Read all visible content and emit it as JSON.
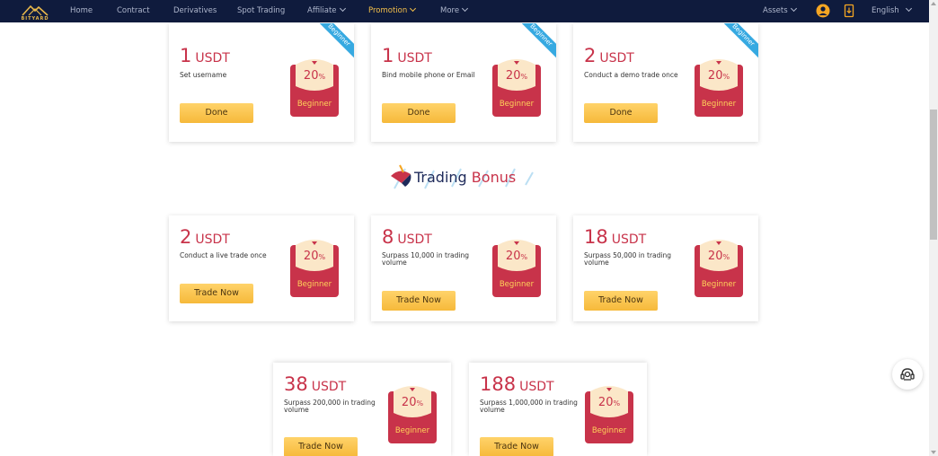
{
  "nav": {
    "logo_text": "BITYARD",
    "items": [
      {
        "label": "Home"
      },
      {
        "label": "Contract"
      },
      {
        "label": "Derivatives"
      },
      {
        "label": "Spot Trading"
      },
      {
        "label": "Affiliate"
      },
      {
        "label": "Promotion"
      },
      {
        "label": "More"
      }
    ],
    "assets": "Assets",
    "language": "English",
    "active_color": "#f5c04a",
    "bg_color": "#0f1b3d"
  },
  "envelope": {
    "percent": "20",
    "percent_sign": "%",
    "label": "Beginner"
  },
  "ribbon_label": "Beginner",
  "top_cards": [
    {
      "amount": "1",
      "unit": "USDT",
      "desc": "Set username",
      "button": "Done"
    },
    {
      "amount": "1",
      "unit": "USDT",
      "desc": "Bind mobile phone or Email",
      "button": "Done"
    },
    {
      "amount": "2",
      "unit": "USDT",
      "desc": "Conduct a demo trade once",
      "button": "Done"
    }
  ],
  "section_title": {
    "part1": "Trading",
    "part2": "Bonus"
  },
  "trading_cards": [
    {
      "amount": "2",
      "unit": "USDT",
      "desc": "Conduct a live trade once",
      "button": "Trade Now"
    },
    {
      "amount": "8",
      "unit": "USDT",
      "desc": "Surpass 10,000 in trading volume",
      "button": "Trade Now"
    },
    {
      "amount": "18",
      "unit": "USDT",
      "desc": "Surpass 50,000 in trading volume",
      "button": "Trade Now"
    },
    {
      "amount": "38",
      "unit": "USDT",
      "desc": "Surpass 200,000 in trading volume",
      "button": "Trade Now"
    },
    {
      "amount": "188",
      "unit": "USDT",
      "desc": "Surpass 1,000,000 in trading volume",
      "button": "Trade Now"
    }
  ],
  "colors": {
    "accent_red": "#c8334a",
    "button_yellow": "#f6b93a",
    "ribbon_blue": "#36a9e1"
  }
}
